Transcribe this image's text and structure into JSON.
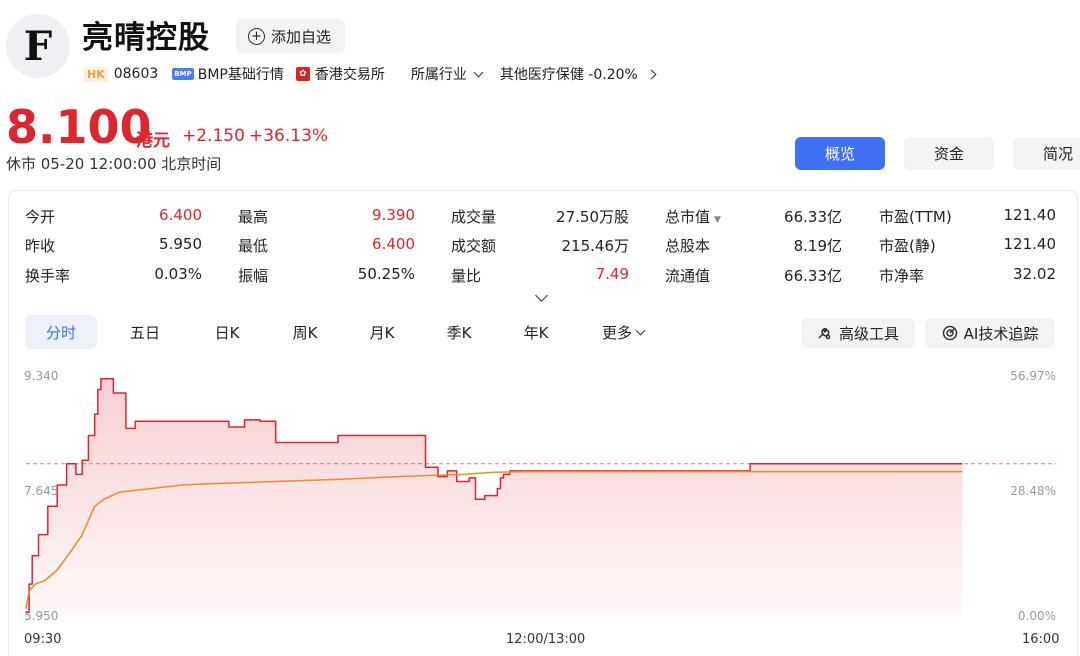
{
  "stock": {
    "logo_letter": "F",
    "name": "亮晴控股",
    "add_watch_label": "添加自选",
    "market_badge": "HK",
    "code": "08603",
    "bmp_badge": "BMP",
    "bmp_label": "BMP基础行情",
    "exchange": "香港交易所",
    "industry_label": "所属行业",
    "sector": "其他医疗保健 -0.20%",
    "price": "8.100",
    "currency": "港元",
    "change": "+2.150",
    "change_pct": "+36.13%",
    "status": "休市 05-20 12:00:00 北京时间"
  },
  "view_tabs": [
    {
      "label": "概览",
      "active": true
    },
    {
      "label": "资金",
      "active": false
    },
    {
      "label": "简况",
      "active": false
    }
  ],
  "quote": {
    "col1": [
      {
        "label": "今开",
        "value": "6.400",
        "red": true
      },
      {
        "label": "昨收",
        "value": "5.950",
        "red": false
      },
      {
        "label": "换手率",
        "value": "0.03%",
        "red": false
      }
    ],
    "col2": [
      {
        "label": "最高",
        "value": "9.390",
        "red": true
      },
      {
        "label": "最低",
        "value": "6.400",
        "red": true
      },
      {
        "label": "振幅",
        "value": "50.25%",
        "red": false
      }
    ],
    "col3": [
      {
        "label": "成交量",
        "value": "27.50万股",
        "red": false
      },
      {
        "label": "成交额",
        "value": "215.46万",
        "red": false
      },
      {
        "label": "量比",
        "value": "7.49",
        "red": true
      }
    ],
    "col4": [
      {
        "label": "总市值",
        "value": "66.33亿",
        "red": false
      },
      {
        "label": "总股本",
        "value": "8.19亿",
        "red": false
      },
      {
        "label": "流通值",
        "value": "66.33亿",
        "red": false
      }
    ],
    "col5": [
      {
        "label": "市盈(TTM)",
        "value": "121.40",
        "red": false
      },
      {
        "label": "市盈(静)",
        "value": "121.40",
        "red": false
      },
      {
        "label": "市净率",
        "value": "32.02",
        "red": false
      }
    ]
  },
  "period_tabs": [
    {
      "label": "分时",
      "active": true
    },
    {
      "label": "五日",
      "active": false
    },
    {
      "label": "日K",
      "active": false
    },
    {
      "label": "周K",
      "active": false
    },
    {
      "label": "月K",
      "active": false
    },
    {
      "label": "季K",
      "active": false
    },
    {
      "label": "年K",
      "active": false
    },
    {
      "label": "更多",
      "active": false
    }
  ],
  "tools": {
    "advanced": "高级工具",
    "ai": "AI技术追踪"
  },
  "colors": {
    "up": "#e0242e",
    "avg": "#f08a24",
    "accent": "#3f6ff2"
  },
  "chart_data": {
    "type": "line",
    "title": "",
    "prev_close": 5.95,
    "y_left_ticks": [
      "9.340",
      "7.645",
      "5.950"
    ],
    "y_right_ticks": [
      "56.97%",
      "28.48%",
      "0.00%"
    ],
    "ylim": [
      5.95,
      9.34
    ],
    "x_labels": [
      "09:30",
      "12:00/13:00",
      "16:00"
    ],
    "total_minutes": 330,
    "series": [
      {
        "key": "price",
        "minute": [
          0,
          1,
          2,
          4,
          7,
          10,
          13,
          16,
          18,
          20,
          22,
          23,
          24,
          27,
          28,
          32,
          35,
          40,
          45,
          55,
          60,
          65,
          70,
          75,
          80,
          85,
          95,
          100,
          110,
          120,
          128,
          132,
          135,
          138,
          142,
          144,
          147,
          150,
          151,
          152,
          153,
          155,
          160,
          170,
          190,
          210,
          231,
          232,
          245,
          260,
          296,
          300
        ],
        "value": [
          6.0,
          6.4,
          6.8,
          7.1,
          7.5,
          7.8,
          8.1,
          7.95,
          8.15,
          8.5,
          8.8,
          9.15,
          9.3,
          9.3,
          9.1,
          8.6,
          8.7,
          8.7,
          8.7,
          8.7,
          8.7,
          8.62,
          8.72,
          8.7,
          8.4,
          8.4,
          8.4,
          8.5,
          8.5,
          8.5,
          8.05,
          7.92,
          8.0,
          7.85,
          7.9,
          7.6,
          7.65,
          7.65,
          7.75,
          7.9,
          7.95,
          8.0,
          8.0,
          8.0,
          8.0,
          8.0,
          8.0,
          8.1,
          8.1,
          8.1,
          8.1,
          8.1
        ]
      },
      {
        "key": "avg",
        "minute": [
          0,
          1,
          3,
          6,
          10,
          15,
          18,
          22,
          25,
          30,
          40,
          50,
          60,
          80,
          100,
          120,
          140,
          150,
          160,
          200,
          250,
          300
        ],
        "value": [
          6.05,
          6.3,
          6.4,
          6.45,
          6.6,
          6.9,
          7.1,
          7.5,
          7.6,
          7.7,
          7.75,
          7.8,
          7.82,
          7.85,
          7.88,
          7.92,
          7.95,
          7.98,
          7.99,
          7.99,
          7.99,
          7.99
        ]
      }
    ]
  }
}
